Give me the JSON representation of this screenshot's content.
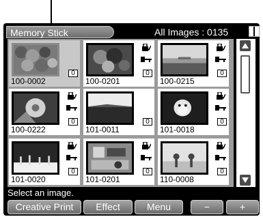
{
  "header": {
    "source_label": "Memory Stick",
    "count_label": "All Images : 0135"
  },
  "thumbnails": [
    {
      "label": "100-0002",
      "protected": false,
      "count": "0"
    },
    {
      "label": "100-0201",
      "protected": true,
      "count": "0"
    },
    {
      "label": "100-0215",
      "protected": true,
      "count": "0"
    },
    {
      "label": "100-0222",
      "protected": true,
      "count": "0"
    },
    {
      "label": "101-0011",
      "protected": false,
      "count": "0"
    },
    {
      "label": "101-0018",
      "protected": true,
      "count": "0"
    },
    {
      "label": "101-0020",
      "protected": true,
      "count": "0"
    },
    {
      "label": "101-0201",
      "protected": true,
      "count": "0"
    },
    {
      "label": "110-0008",
      "protected": true,
      "count": "0"
    }
  ],
  "status": "Select an image.",
  "buttons": {
    "creative_print": "Creative Print",
    "effect": "Effect",
    "menu": "Menu",
    "minus": "−",
    "plus": "+"
  }
}
